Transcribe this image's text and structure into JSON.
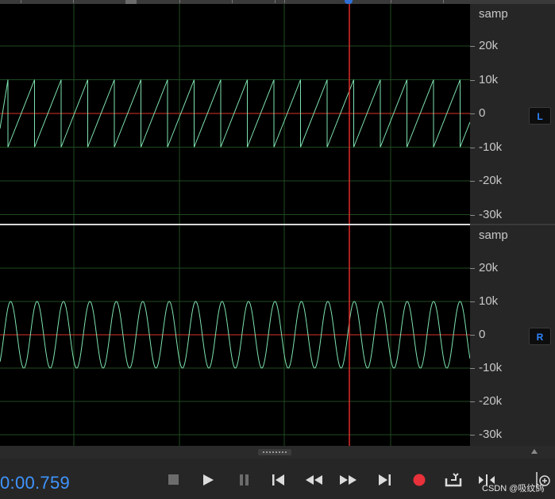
{
  "waveform": {
    "scale_unit": "samp",
    "scale_labels": [
      "20k",
      "10k",
      "0",
      "-10k",
      "-20k",
      "-30k"
    ],
    "channels": [
      {
        "id": "left",
        "badge": "L",
        "wave": "sawtooth"
      },
      {
        "id": "right",
        "badge": "R",
        "wave": "sine"
      }
    ],
    "colors": {
      "wave": "#7ee3b0",
      "zero_line": "#d9342b",
      "grid": "#1f4a1f",
      "playhead": "#e02a2a",
      "accent": "#3f95ff"
    }
  },
  "transport": {
    "time": "0:00.759",
    "buttons": [
      "stop",
      "play",
      "pause",
      "go-to-start",
      "rewind",
      "fast-forward",
      "go-to-end",
      "record",
      "loop",
      "skip",
      "zoom"
    ]
  },
  "watermark": "CSDN @吸纹鸽"
}
